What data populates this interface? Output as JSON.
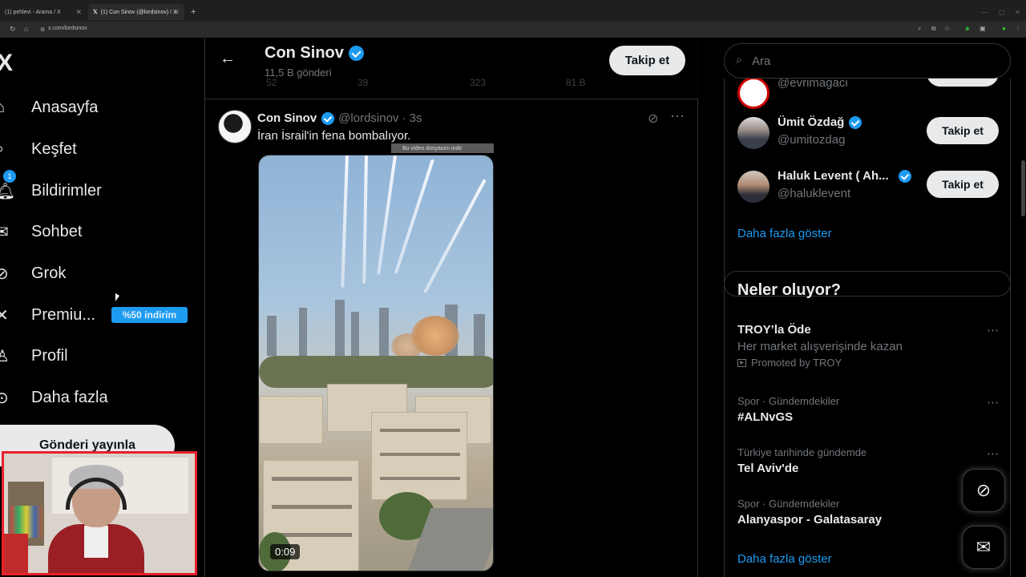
{
  "browser": {
    "tabs": [
      {
        "label": "(1) pehlevi - Arama / X"
      },
      {
        "label": "(1) Con Sinov (@lordsinov) / X"
      }
    ],
    "url": "x.com/lordsinov"
  },
  "leftnav": {
    "logo": "X",
    "items": [
      {
        "label": "Anasayfa",
        "icon": "home-icon"
      },
      {
        "label": "Keşfet",
        "icon": "search-icon"
      },
      {
        "label": "Bildirimler",
        "icon": "bell-icon",
        "badge": "1"
      },
      {
        "label": "Sohbet",
        "icon": "mail-icon"
      },
      {
        "label": "Grok",
        "icon": "grok-icon"
      },
      {
        "label": "Premiu...",
        "icon": "x-icon"
      },
      {
        "label": "Profil",
        "icon": "person-icon"
      },
      {
        "label": "Daha fazla",
        "icon": "more-circle-icon"
      }
    ],
    "promo": "%50 indirim",
    "post_button": "Gönderi yayınla"
  },
  "profile_header": {
    "name": "Con Sinov",
    "post_count": "11,5 B gönderi",
    "follow": "Takip et",
    "ghost_stats": [
      "52",
      "39",
      "323",
      "81 B"
    ]
  },
  "tweet": {
    "name": "Con Sinov",
    "handle": "@lordsinov",
    "time": "· 3s",
    "text": "İran İsrail'in fena bombalıyor.",
    "download_bar": "Bu video dosyasını indir",
    "video_time": "0:09"
  },
  "search": {
    "placeholder": "Ara"
  },
  "who_to_follow": {
    "partial_handle": "@evrimagaci",
    "users": [
      {
        "name": "Ümit Özdağ",
        "handle": "@umitozdag",
        "button": "Takip et"
      },
      {
        "name": "Haluk Levent ( Ah...",
        "handle": "@haluklevent",
        "button": "Takip et"
      }
    ],
    "show_more": "Daha fazla göster"
  },
  "trends": {
    "title": "Neler oluyor?",
    "items": [
      {
        "meta": "",
        "name": "TROY’la Öde",
        "sub": "Her market alışverişinde kazan",
        "promo": "Promoted by TROY"
      },
      {
        "meta": "Spor · Gündemdekiler",
        "name": "#ALNvGS"
      },
      {
        "meta": "Türkiye tarihinde gündemde",
        "name": "Tel Aviv'de"
      },
      {
        "meta": "Spor · Gündemdekiler",
        "name": "Alanyaspor - Galatasaray"
      }
    ],
    "show_more": "Daha fazla göster"
  },
  "colors": {
    "accent": "#1d9bf0",
    "background": "#000000",
    "webcam_border": "#e8202a"
  }
}
